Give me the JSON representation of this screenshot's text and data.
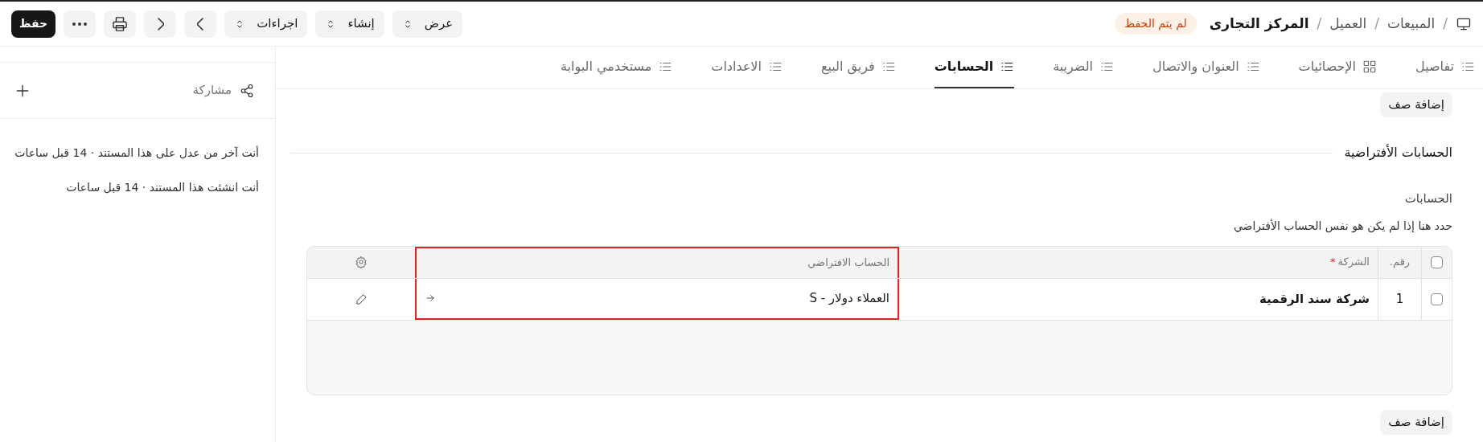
{
  "breadcrumbs": [
    {
      "separator": "/",
      "label": "المبيعات"
    },
    {
      "separator": "/",
      "label": "العميل"
    },
    {
      "separator": "/",
      "label": "المركز التجارى"
    }
  ],
  "status_badge": "لم يتم الحفظ",
  "toolbar": [
    {
      "kind": "dropdown",
      "label": "عرض"
    },
    {
      "kind": "dropdown",
      "label": "إنشاء"
    },
    {
      "kind": "dropdown",
      "label": "اجراءات"
    },
    {
      "kind": "prev"
    },
    {
      "kind": "next"
    },
    {
      "kind": "print"
    },
    {
      "kind": "more"
    },
    {
      "kind": "primary",
      "label": "حفظ"
    }
  ],
  "tabs": [
    {
      "label": "تفاصيل",
      "kind": "list",
      "selected": false
    },
    {
      "label": "الإحصائيات",
      "kind": "grid",
      "selected": false
    },
    {
      "label": "العنوان والاتصال",
      "kind": "list",
      "selected": false
    },
    {
      "label": "الضريبة",
      "kind": "list",
      "selected": false
    },
    {
      "label": "الحسابات",
      "kind": "list",
      "selected": true
    },
    {
      "label": "فريق البيع",
      "kind": "list",
      "selected": false
    },
    {
      "label": "الاعدادات",
      "kind": "list",
      "selected": false
    },
    {
      "label": "مستخدمي البوابة",
      "kind": "list",
      "selected": false
    }
  ],
  "add_row_top": "إضافة صف",
  "section_title": "الحسابات الأفتراضية",
  "field_label": "الحسابات",
  "field_description": "حدد هنا إذا لم يكن هو نفس الحساب الأفتراضي",
  "table": {
    "all_checked": false,
    "columns": [
      {
        "label": "رقم.",
        "highlighted": false
      },
      {
        "label": "الشركة",
        "required_mark": "*",
        "highlighted": false
      },
      {
        "label": "الحساب الافتراضي",
        "highlighted": true
      }
    ],
    "rows": [
      {
        "checked": false,
        "cells": [
          "1",
          "شركة سند الرقمية",
          "العملاء دولار - S"
        ]
      }
    ]
  },
  "add_row_bottom": "إضافة صف",
  "sidebar": {
    "share_label": "مشاركة",
    "activity": [
      "أنت آخر من عدل على هذا المستند · 14 قبل ساعات",
      "أنت انشئت هذا المستند · 14 قبل ساعات"
    ]
  }
}
